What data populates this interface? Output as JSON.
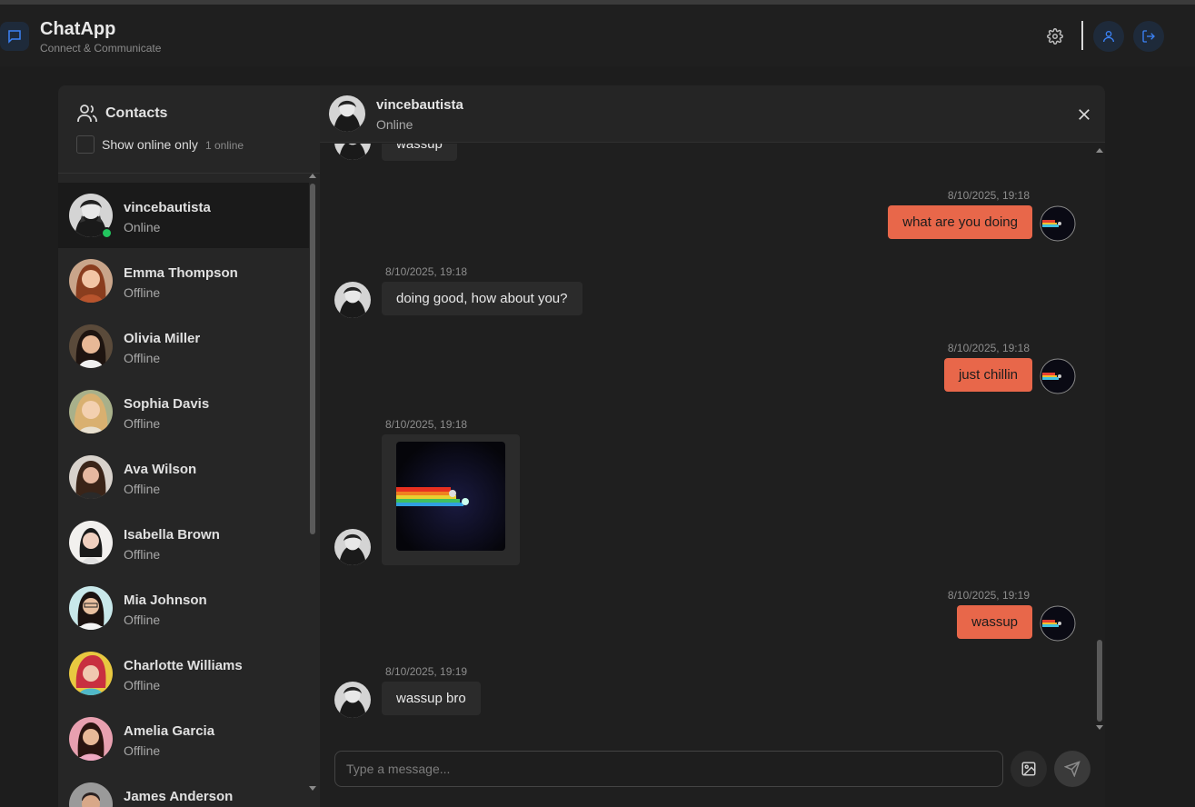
{
  "app": {
    "title": "ChatApp",
    "subtitle": "Connect & Communicate",
    "accent_color": "#e8674a",
    "online_color": "#22c55e",
    "icons": [
      "chat-bubble-icon",
      "settings-icon",
      "user-icon",
      "logout-icon"
    ]
  },
  "contacts_panel": {
    "title": "Contacts",
    "show_online_label": "Show online only",
    "online_count": "1 online",
    "contacts": [
      {
        "name": "vincebautista",
        "status": "Online"
      },
      {
        "name": "Emma Thompson",
        "status": "Offline"
      },
      {
        "name": "Olivia Miller",
        "status": "Offline"
      },
      {
        "name": "Sophia Davis",
        "status": "Offline"
      },
      {
        "name": "Ava Wilson",
        "status": "Offline"
      },
      {
        "name": "Isabella Brown",
        "status": "Offline"
      },
      {
        "name": "Mia Johnson",
        "status": "Offline"
      },
      {
        "name": "Charlotte Williams",
        "status": "Offline"
      },
      {
        "name": "Amelia Garcia",
        "status": "Offline"
      },
      {
        "name": "James Anderson",
        "status": ""
      }
    ]
  },
  "chat": {
    "contact_name": "vincebautista",
    "contact_status": "Online",
    "messages": [
      {
        "text": "wassup"
      },
      {
        "time": "8/10/2025, 19:18",
        "text": "what are you doing"
      },
      {
        "time": "8/10/2025, 19:18",
        "text": "doing good, how about you?"
      },
      {
        "time": "8/10/2025, 19:18",
        "text": "just chillin"
      },
      {
        "time": "8/10/2025, 19:18"
      },
      {
        "time": "8/10/2025, 19:19",
        "text": "wassup"
      },
      {
        "time": "8/10/2025, 19:19",
        "text": "wassup bro"
      }
    ],
    "composer_placeholder": "Type a message..."
  }
}
